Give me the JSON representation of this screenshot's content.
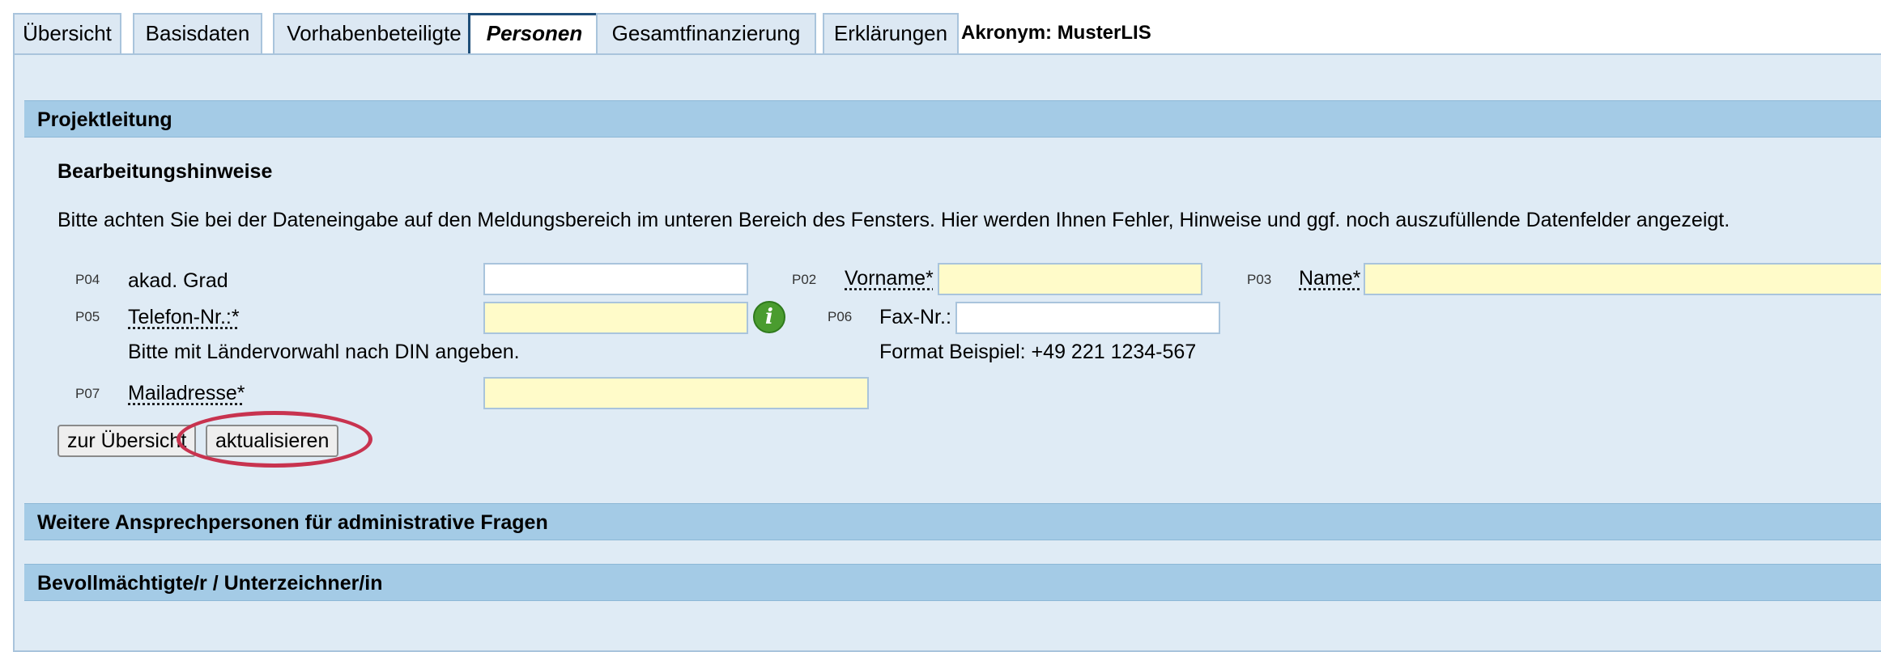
{
  "tabs": [
    {
      "label": "Übersicht"
    },
    {
      "label": "Basisdaten"
    },
    {
      "label": "Vorhabenbeteiligte"
    },
    {
      "label": "Personen"
    },
    {
      "label": "Gesamtfinanzierung"
    },
    {
      "label": "Erklärungen"
    }
  ],
  "active_tab": "Personen",
  "acronym": "Akronym: MusterLIS",
  "sections": {
    "projektleitung": "Projektleitung",
    "weitere": "Weitere Ansprechpersonen für administrative Fragen",
    "bevollmaechtigte": "Bevollmächtigte/r / Unterzeichner/in"
  },
  "hints": {
    "title": "Bearbeitungshinweise",
    "text": "Bitte achten Sie bei der Dateneingabe auf den Meldungsbereich im unteren Bereich des Fensters. Hier werden Ihnen Fehler, Hinweise und ggf. noch auszufüllende Datenfelder angezeigt."
  },
  "fields": {
    "p04": {
      "code": "P04",
      "label": "akad. Grad",
      "value": ""
    },
    "p02": {
      "code": "P02",
      "label": "Vorname*",
      "value": ""
    },
    "p03": {
      "code": "P03",
      "label": "Name*",
      "value": ""
    },
    "p05": {
      "code": "P05",
      "label": "Telefon-Nr.:*",
      "value": "",
      "note": "Bitte mit Ländervorwahl nach DIN angeben."
    },
    "p06": {
      "code": "P06",
      "label": "Fax-Nr.:",
      "value": "",
      "note": "Format Beispiel: +49 221 1234-567"
    },
    "p07": {
      "code": "P07",
      "label": "Mailadresse*",
      "value": ""
    }
  },
  "info_icon": "info-icon",
  "buttons": {
    "overview": "zur Übersicht",
    "update": "aktualisieren"
  },
  "colors": {
    "required_field": "#fffbc9",
    "section_bar": "#a4cbe6",
    "panel": "#dfebf5",
    "highlight": "#c8334f"
  }
}
